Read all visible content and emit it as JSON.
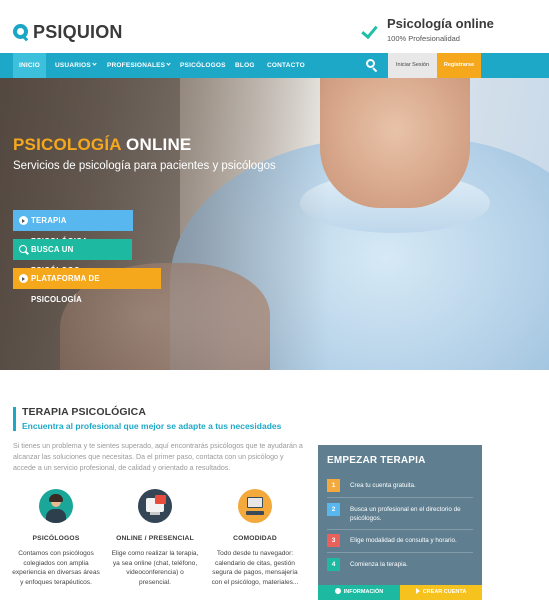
{
  "header": {
    "logo_text": "PSIQUION",
    "tagline_title": "Psicología online",
    "tagline_sub": "100% Profesionalidad"
  },
  "nav": {
    "items": [
      {
        "label": "Inicio",
        "active": true
      },
      {
        "label": "Usuarios",
        "dropdown": true
      },
      {
        "label": "Profesionales",
        "dropdown": true
      },
      {
        "label": "Psicólogos"
      },
      {
        "label": "Blog"
      },
      {
        "label": "Contacto"
      }
    ],
    "login_label": "Iniciar Sesión",
    "register_label": "Registrarse"
  },
  "hero": {
    "title_part1": "PSICOLOGÍA",
    "title_part2": "ONLINE",
    "subtitle": "Servicios de psicología para pacientes y psicólogos",
    "buttons": [
      {
        "label": "Terapia psicológica",
        "color": "#57b7ee",
        "icon": "arrow-circle-icon"
      },
      {
        "label": "Busca un psicólogo",
        "color": "#1dbaa1",
        "icon": "search-icon"
      },
      {
        "label": "Plataforma de psicología",
        "color": "#f6a81d",
        "icon": "arrow-circle-icon"
      }
    ]
  },
  "section": {
    "title": "TERAPIA PSICOLÓGICA",
    "subtitle": "Encuentra al profesional que mejor se adapte a tus necesidades",
    "description": "Si tienes un problema y te sientes superado, aquí encontrarás psicólogos que te ayudarán a alcanzar las soluciones que necesitas. Da el primer paso, contacta con un psicólogo y accede a un servicio profesional, de calidad y orientado a resultados."
  },
  "features": [
    {
      "title": "Psicólogos",
      "description": "Contamos con psicólogos colegiados con amplia experiencia en diversas áreas y enfoques terapéuticos.",
      "icon": "psychologist-icon"
    },
    {
      "title": "Online / Presencial",
      "description": "Elige como realizar la terapia, ya sea online (chat, teléfono, videoconferencia) o presencial.",
      "icon": "online-devices-icon"
    },
    {
      "title": "Comodidad",
      "description": "Todo desde tu navegador: calendario de citas, gestión segura de pagos, mensajería con el psicólogo, materiales...",
      "icon": "computer-icon"
    }
  ],
  "panel": {
    "title": "EMPEZAR TERAPIA",
    "steps": [
      {
        "num": "1",
        "text": "Crea tu cuenta gratuita.",
        "color": "#f3a93b"
      },
      {
        "num": "2",
        "text": "Busca un profesional en el directorio de psicólogos.",
        "color": "#57b7ee"
      },
      {
        "num": "3",
        "text": "Elige modalidad de consulta y horario.",
        "color": "#e8615b"
      },
      {
        "num": "4",
        "text": "Comienza la terapia.",
        "color": "#1dbaa1"
      }
    ],
    "info_label": "Información",
    "create_label": "Crear cuenta"
  },
  "colors": {
    "brand": "#1ea8c8",
    "accent_orange": "#f6a81d",
    "accent_green": "#1dbaa1",
    "panel_bg": "#5f7f91"
  }
}
